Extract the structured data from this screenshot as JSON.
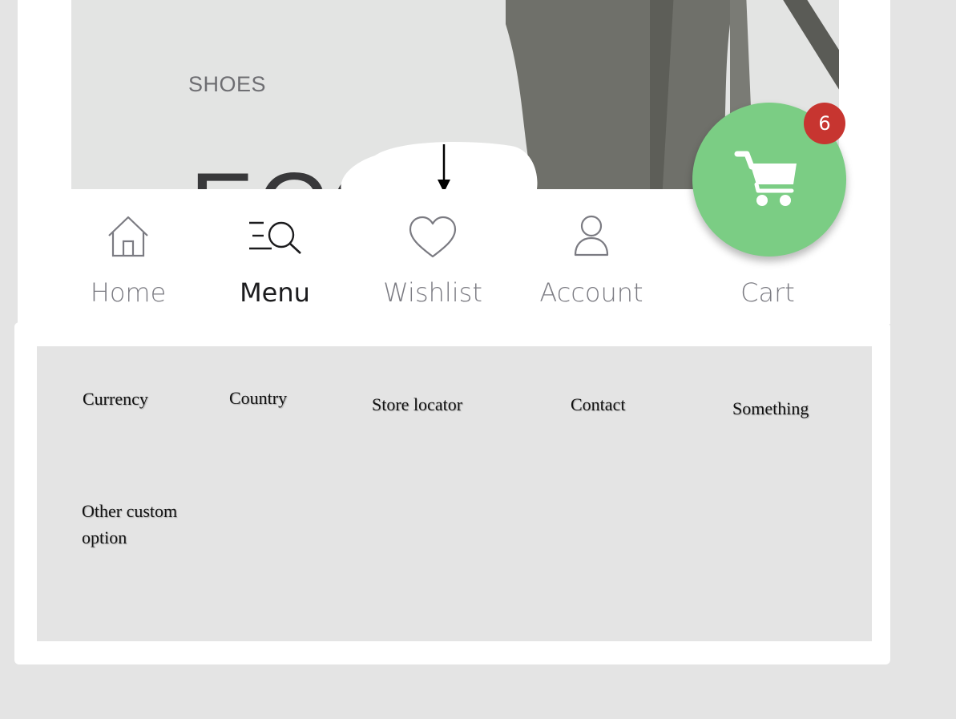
{
  "hero": {
    "category": "SHOES",
    "headline": "ECC"
  },
  "nav": {
    "items": [
      {
        "label": "Home",
        "icon": "home-icon",
        "active": false
      },
      {
        "label": "Menu",
        "icon": "menu-search-icon",
        "active": true
      },
      {
        "label": "Wishlist",
        "icon": "heart-icon",
        "active": false
      },
      {
        "label": "Account",
        "icon": "user-icon",
        "active": false
      },
      {
        "label": "Cart",
        "icon": "cart-icon",
        "active": false
      }
    ],
    "cart_count": "6"
  },
  "menu_options": [
    {
      "label": "Currency"
    },
    {
      "label": "Country"
    },
    {
      "label": "Store locator"
    },
    {
      "label": "Contact"
    },
    {
      "label": "Something"
    },
    {
      "label": "Other custom option"
    }
  ],
  "colors": {
    "cart_fab": "#7bcd84",
    "badge": "#c73530",
    "icon_stroke": "#7b7b82",
    "active_text": "#1c1c1e",
    "background": "#e4e4e4"
  }
}
